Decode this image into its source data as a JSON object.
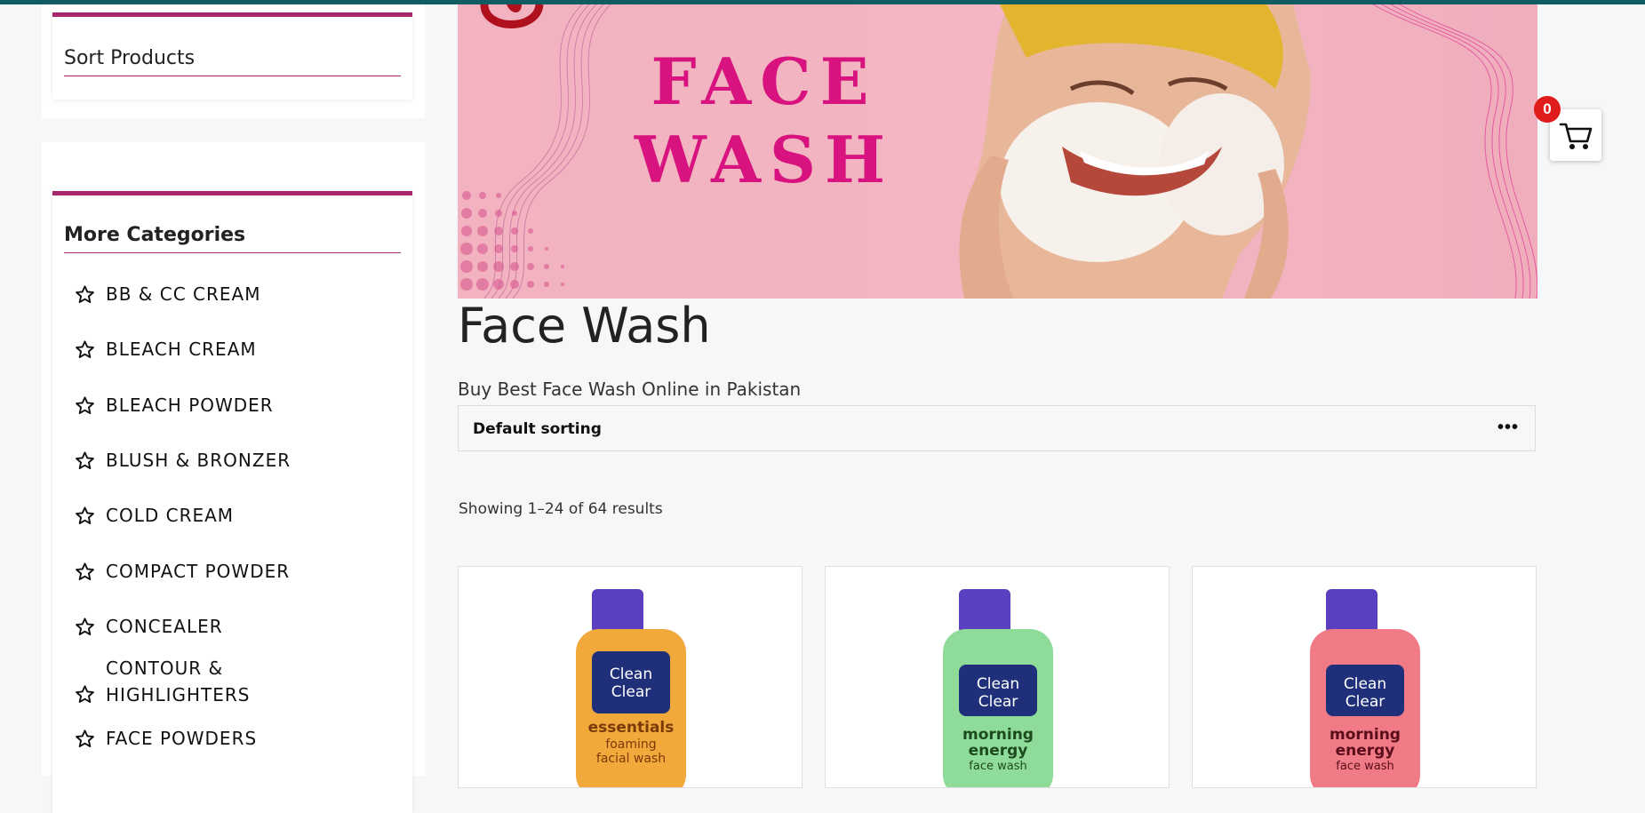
{
  "sidebar": {
    "sort_title": "Sort Products",
    "categories_title": "More Categories",
    "categories": [
      {
        "label": "BB & CC CREAM"
      },
      {
        "label": "BLEACH CREAM"
      },
      {
        "label": "BLEACH POWDER"
      },
      {
        "label": "BLUSH & BRONZER"
      },
      {
        "label": "COLD CREAM"
      },
      {
        "label": "COMPACT POWDER"
      },
      {
        "label": "CONCEALER"
      },
      {
        "label_line1": "CONTOUR &",
        "label_line2": "HIGHLIGHTERS"
      },
      {
        "label": "FACE POWDERS"
      }
    ]
  },
  "hero": {
    "line1": "FACE",
    "line2": "WASH"
  },
  "main": {
    "title": "Face Wash",
    "subtitle": "Buy Best Face Wash Online in Pakistan",
    "sort_value": "Default sorting",
    "sort_more": "•••",
    "result_count": "Showing 1–24 of 64 results"
  },
  "products": [
    {
      "brand_line1": "Clean",
      "brand_line2": "Clear",
      "name_line1": "essentials",
      "name_line2": "foaming",
      "name_line3": "facial wash",
      "bottle_color": "#f2a93b"
    },
    {
      "brand_line1": "Clean",
      "brand_line2": "Clear",
      "name_line1": "morning",
      "name_line2": "energy",
      "name_line3": "face wash",
      "bottle_color": "#8fdc9a"
    },
    {
      "brand_line1": "Clean",
      "brand_line2": "Clear",
      "name_line1": "morning",
      "name_line2": "energy",
      "name_line3": "face wash",
      "bottle_color": "#f07a86"
    }
  ],
  "cart": {
    "count": "0"
  },
  "colors": {
    "accent": "#a8266b",
    "topbar": "#0f5c63",
    "hero_text": "#d8127e",
    "badge": "#e01b1b"
  }
}
